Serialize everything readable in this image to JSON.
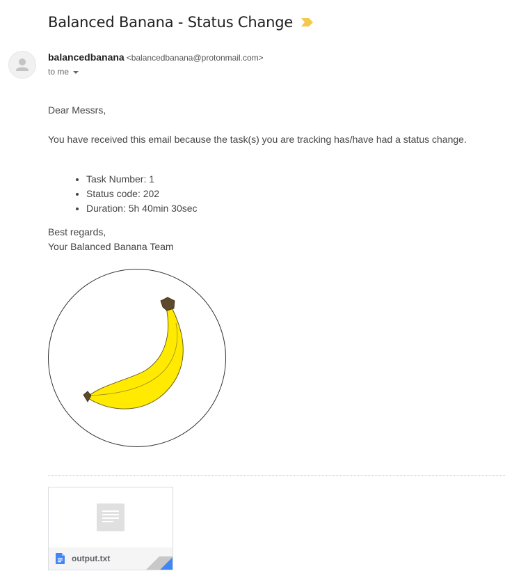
{
  "email": {
    "subject": "Balanced Banana - Status Change",
    "importance_icon": "importance-marker-icon",
    "importance_color": "#f2c94c",
    "sender": {
      "name": "balancedbanana",
      "email": "<balancedbanana@protonmail.com>",
      "avatar_icon": "person-icon"
    },
    "recipient_label": "to me",
    "recipient_dropdown_icon": "caret-down-icon",
    "greeting": "Dear Messrs,",
    "intro": "You have received this email because the task(s) you are tracking has/have had a status change.",
    "details": [
      "Task Number: 1",
      "Status code: 202",
      "Duration: 5h 40min 30sec"
    ],
    "closing": "Best regards,",
    "signature": "Your Balanced Banana Team",
    "logo": {
      "icon": "banana-logo",
      "banana_color": "#ffea00",
      "stem_color": "#5d4a2c"
    }
  },
  "attachment": {
    "file_name": "output.txt",
    "file_icon": "document-icon",
    "file_icon_color": "#4285f4",
    "preview_icon": "text-document-preview-icon"
  }
}
